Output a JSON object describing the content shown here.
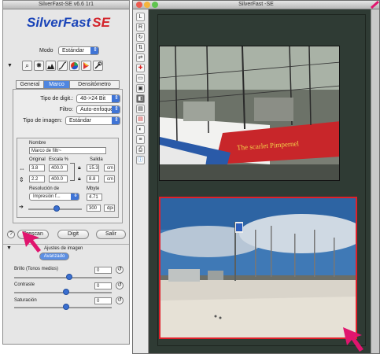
{
  "left_window": {
    "title": "SilverFast-SE v6.6 1r1",
    "logo_main": "SilverFast",
    "logo_se": "SE",
    "mode_label": "Modo",
    "mode_value": "Estándar",
    "tabs": [
      "General",
      "Marco",
      "Densitómetro"
    ],
    "scan_type_label": "Tipo de digit.:",
    "scan_type_value": "48->24 Bit",
    "filter_label": "Filtro:",
    "filter_value": "Auto-enfoque",
    "image_type_label": "Tipo de imagen:",
    "image_type_value": "Estándar",
    "name_label": "Nombre",
    "name_value": "Marco de filtr~",
    "original_label": "Original",
    "scale_label": "Escala %",
    "output_label": "Salida",
    "orig_w": "3.8",
    "orig_h": "2.2",
    "scale_w": "400.0",
    "scale_h": "400.0",
    "out_w": "15.3",
    "out_h": "8.8",
    "unit": "cm",
    "resolution_label": "Resolución de",
    "mbyte_label": "Mbyte",
    "resolution_value": "Impresión f...",
    "mbyte_value": "4.71",
    "resolution_number": "300",
    "resolution_unit": "dpi",
    "prescan_button": "Prescan",
    "scan_button": "Digit",
    "exit_button": "Salir",
    "image_settings_label": "Ajustes de imagen",
    "advanced_button": "Avanzado",
    "brightness_label": "Brillo (Tonos medios)",
    "brightness_value": "0",
    "contrast_label": "Contraste",
    "contrast_value": "0",
    "saturation_label": "Saturación",
    "saturation_value": "0"
  },
  "right_window": {
    "title": "SilverFast -SE",
    "boat_text": "The scarlet Pimpernel"
  },
  "colors": {
    "accent": "#3f74d6",
    "logo_blue": "#1a44b8",
    "logo_red": "#d3242b",
    "pointer": "#e0156e",
    "frame_red": "#e0202a"
  },
  "icons": [
    "magnifier-icon",
    "star-icon",
    "histogram-icon",
    "curves-icon",
    "color-wheel-icon",
    "selective-color-icon",
    "tool-icon"
  ]
}
